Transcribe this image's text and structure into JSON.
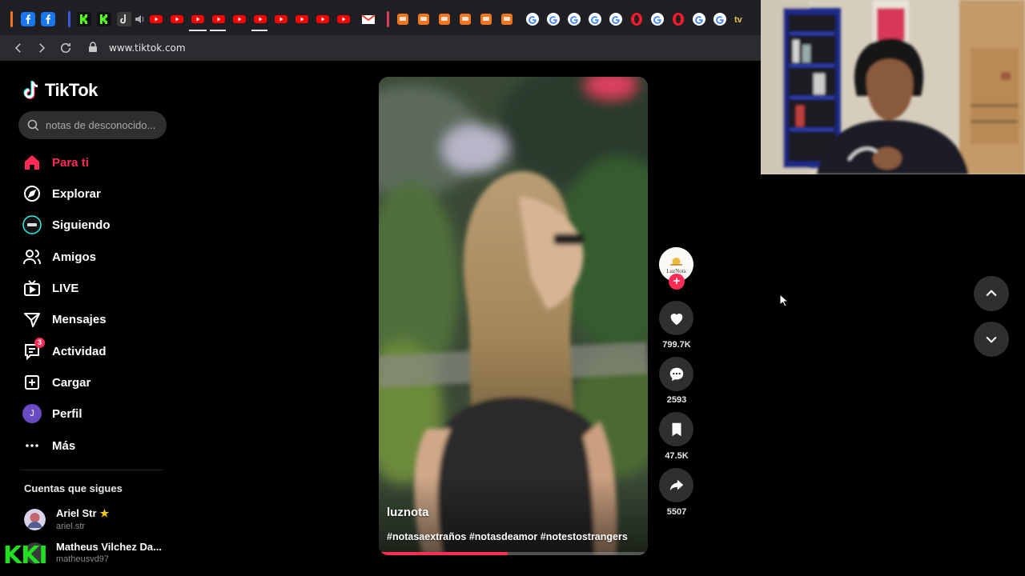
{
  "browser": {
    "url": "www.tiktok.com"
  },
  "sidebar": {
    "logo_text": "TikTok",
    "search_placeholder": "notas de desconocido...",
    "items": [
      {
        "label": "Para ti",
        "icon": "home-icon",
        "active": true
      },
      {
        "label": "Explorar",
        "icon": "compass-icon"
      },
      {
        "label": "Siguiendo",
        "icon": "following-icon"
      },
      {
        "label": "Amigos",
        "icon": "friends-icon"
      },
      {
        "label": "LIVE",
        "icon": "live-icon"
      },
      {
        "label": "Mensajes",
        "icon": "messages-icon"
      },
      {
        "label": "Actividad",
        "icon": "activity-icon",
        "badge": "3"
      },
      {
        "label": "Cargar",
        "icon": "upload-icon"
      },
      {
        "label": "Perfil",
        "icon": "profile-avatar",
        "avatar_letter": "J"
      },
      {
        "label": "Más",
        "icon": "more-icon"
      }
    ],
    "following_title": "Cuentas que sigues",
    "accounts": [
      {
        "name": "Ariel Str",
        "handle": "ariel.str"
      },
      {
        "name": "Matheus Vilchez Da...",
        "handle": "matheusvd97"
      }
    ]
  },
  "video": {
    "author": "luznota",
    "hashtags": "#notasaextraños #notasdeamor #notestostrangers",
    "progress": 0.48
  },
  "actions": {
    "creator_avatar_text": "LuzNota",
    "likes": "799.7K",
    "comments": "2593",
    "saves": "47.5K",
    "shares": "5507"
  },
  "overlay_text": "KKI",
  "colors": {
    "accent": "#fe2c55",
    "background": "#000000",
    "button_bg": "#2f2f2f"
  }
}
